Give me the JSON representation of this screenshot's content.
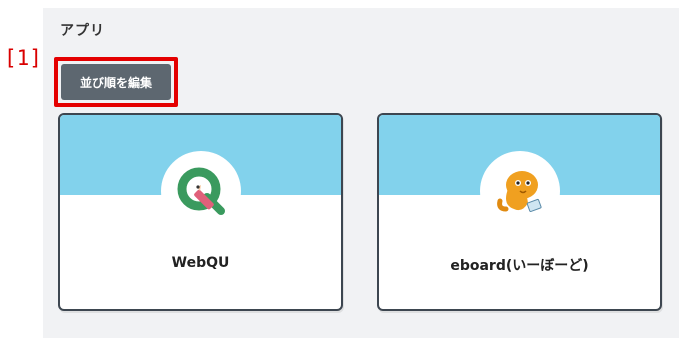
{
  "annotation": {
    "marker": "[1]"
  },
  "section": {
    "title": "アプリ"
  },
  "toolbar": {
    "edit_order_label": "並び順を編集"
  },
  "apps": [
    {
      "name": "WebQU",
      "icon": "webqu-logo-icon"
    },
    {
      "name": "eboard(いーぼーど)",
      "icon": "eboard-mascot-icon"
    }
  ],
  "colors": {
    "banner": "#82d2ec",
    "button": "#5d6770",
    "highlight": "#e40000",
    "panel": "#f1f2f4"
  }
}
